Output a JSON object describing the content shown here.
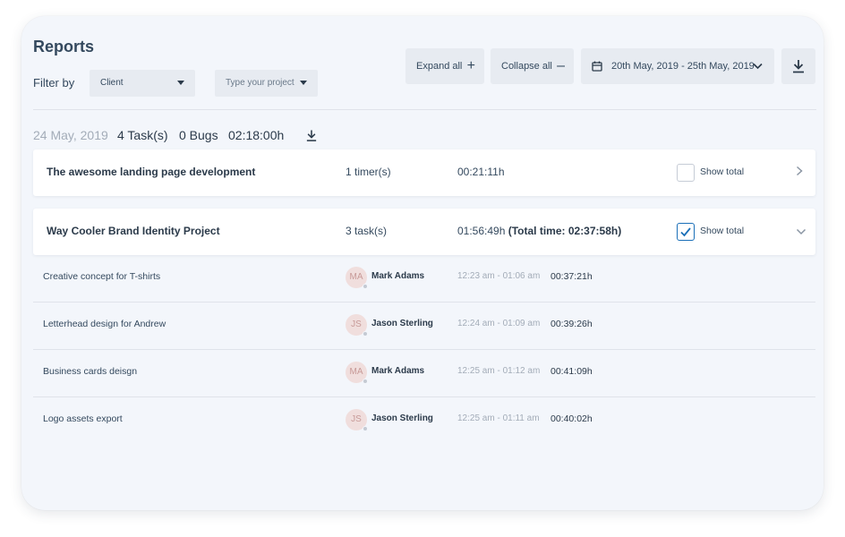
{
  "header": {
    "title": "Reports",
    "filter_label": "Filter by",
    "client_select": "Client",
    "project_placeholder": "Type your project",
    "expand_all": "Expand all",
    "collapse_all": "Collapse all",
    "date_range": "20th May, 2019 - 25th May, 2019"
  },
  "summary": {
    "date": "24 May, 2019",
    "tasks": "4 Task(s)",
    "bugs": "0 Bugs",
    "duration": "02:18:00h"
  },
  "projects": [
    {
      "name": "The awesome landing page development",
      "count": "1 timer(s)",
      "time": "00:21:11h",
      "total": "",
      "show_total_label": "Show total",
      "show_total_checked": false,
      "expanded": false
    },
    {
      "name": "Way Cooler Brand Identity Project",
      "count": "3 task(s)",
      "time": "01:56:49h",
      "total": "(Total time: 02:37:58h)",
      "show_total_label": "Show total",
      "show_total_checked": true,
      "expanded": true
    }
  ],
  "tasks": [
    {
      "name": "Creative concept for T-shirts",
      "initials": "MA",
      "user": "Mark Adams",
      "range": "12:23 am - 01:06 am",
      "duration": "00:37:21h"
    },
    {
      "name": "Letterhead design for Andrew",
      "initials": "JS",
      "user": "Jason Sterling",
      "range": "12:24 am - 01:09 am",
      "duration": "00:39:26h"
    },
    {
      "name": "Business cards deisgn",
      "initials": "MA",
      "user": "Mark Adams",
      "range": "12:25 am - 01:12 am",
      "duration": "00:41:09h"
    },
    {
      "name": "Logo assets export",
      "initials": "JS",
      "user": "Jason Sterling",
      "range": "12:25 am - 01:11 am",
      "duration": "00:40:02h"
    }
  ],
  "colors": {
    "background": "#f3f6fb",
    "accent": "#1a6fb8",
    "avatar_bg": "#f0dedd",
    "muted_text": "#a3acb8"
  }
}
